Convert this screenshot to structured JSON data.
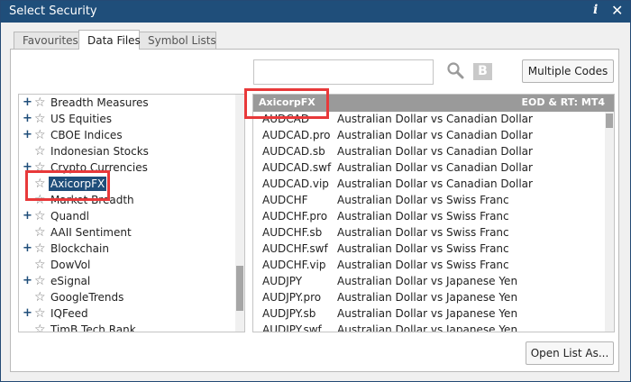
{
  "window": {
    "title": "Select Security",
    "info_glyph": "i",
    "close_glyph": "✕"
  },
  "tabs": [
    {
      "label": "Favourites",
      "active": false
    },
    {
      "label": "Data Files",
      "active": true
    },
    {
      "label": "Symbol Lists",
      "active": false
    }
  ],
  "search": {
    "value": "",
    "placeholder": ""
  },
  "toolbar": {
    "bold_label": "B",
    "multiple_codes_label": "Multiple Codes",
    "open_list_label": "Open List As..."
  },
  "tree": {
    "items": [
      {
        "label": "Breadth Measures",
        "expander": "+"
      },
      {
        "label": "US Equities",
        "expander": "+"
      },
      {
        "label": "CBOE Indices",
        "expander": "+"
      },
      {
        "label": "Indonesian Stocks",
        "expander": ""
      },
      {
        "label": "Crypto Currencies",
        "expander": "+"
      },
      {
        "label": "AxicorpFX",
        "expander": "",
        "selected": true
      },
      {
        "label": "Market Breadth",
        "expander": ""
      },
      {
        "label": "Quandl",
        "expander": "+"
      },
      {
        "label": "AAII Sentiment",
        "expander": ""
      },
      {
        "label": "Blockchain",
        "expander": "+"
      },
      {
        "label": "DowVol",
        "expander": ""
      },
      {
        "label": "eSignal",
        "expander": "+"
      },
      {
        "label": "GoogleTrends",
        "expander": ""
      },
      {
        "label": "IQFeed",
        "expander": "+"
      },
      {
        "label": "TimB Tech Rank",
        "expander": ""
      }
    ]
  },
  "list": {
    "header_left": "AxicorpFX",
    "header_right": "EOD & RT: MT4",
    "rows": [
      {
        "code": "AUDCAD",
        "desc": "Australian Dollar vs Canadian Dollar"
      },
      {
        "code": "AUDCAD.pro",
        "desc": "Australian Dollar vs Canadian Dollar"
      },
      {
        "code": "AUDCAD.sb",
        "desc": "Australian Dollar vs Canadian Dollar"
      },
      {
        "code": "AUDCAD.swf",
        "desc": "Australian Dollar vs Canadian Dollar"
      },
      {
        "code": "AUDCAD.vip",
        "desc": "Australian Dollar vs Canadian Dollar"
      },
      {
        "code": "AUDCHF",
        "desc": "Australian Dollar vs Swiss Franc"
      },
      {
        "code": "AUDCHF.pro",
        "desc": "Australian Dollar vs Swiss Franc"
      },
      {
        "code": "AUDCHF.sb",
        "desc": "Australian Dollar vs Swiss Franc"
      },
      {
        "code": "AUDCHF.swf",
        "desc": "Australian Dollar vs Swiss Franc"
      },
      {
        "code": "AUDCHF.vip",
        "desc": "Australian Dollar vs Swiss Franc"
      },
      {
        "code": "AUDJPY",
        "desc": "Australian Dollar vs Japanese Yen"
      },
      {
        "code": "AUDJPY.pro",
        "desc": "Australian Dollar vs Japanese Yen"
      },
      {
        "code": "AUDJPY.sb",
        "desc": "Australian Dollar vs Japanese Yen"
      },
      {
        "code": "AUDJPY.swf",
        "desc": "Australian Dollar vs Japanese Yen"
      }
    ]
  },
  "colors": {
    "titlebar": "#1f4e7a",
    "selection": "#1f4e7a",
    "highlight": "#e8393a",
    "list_header": "#9a9a9a"
  }
}
